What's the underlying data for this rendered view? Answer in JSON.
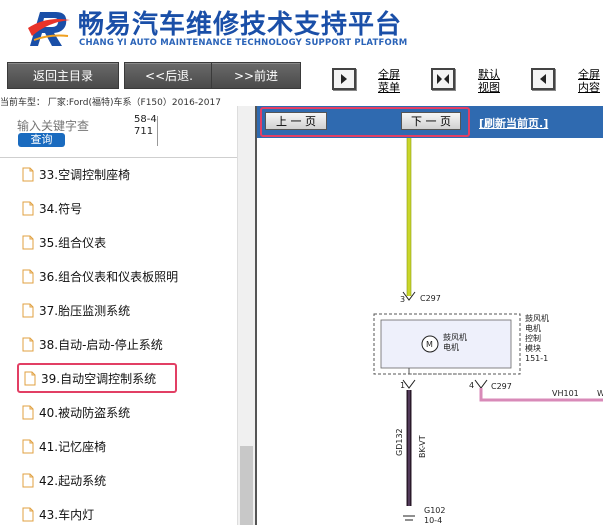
{
  "header": {
    "title": "畅易汽车维修技术支持平台",
    "subtitle": "CHANG YI AUTO MAINTENANCE TECHNOLOGY SUPPORT PLATFORM"
  },
  "toolbar": {
    "home_label": "返回主目录",
    "back_label": "<<后退.",
    "forward_label": ">>前进",
    "fullscreen_menu_line1": "全屏",
    "fullscreen_menu_line2": "菜单",
    "default_view_line1": "默认",
    "default_view_line2": "视图",
    "fullscreen_content_line1": "全屏",
    "fullscreen_content_line2": "内容"
  },
  "vehicle_info": "当前车型：  厂家:Ford(福特)车系（F150）2016-2017",
  "search": {
    "placeholder": "输入关键字查",
    "button_label": "查询",
    "page_ref": "58-4711"
  },
  "sidebar_items": [
    {
      "label": "33.空调控制座椅",
      "selected": false
    },
    {
      "label": "34.符号",
      "selected": false
    },
    {
      "label": "35.组合仪表",
      "selected": false
    },
    {
      "label": "36.组合仪表和仪表板照明",
      "selected": false
    },
    {
      "label": "37.胎压监测系统",
      "selected": false
    },
    {
      "label": "38.自动-启动-停止系统",
      "selected": false
    },
    {
      "label": "39.自动空调控制系统",
      "selected": true
    },
    {
      "label": "40.被动防盗系统",
      "selected": false
    },
    {
      "label": "41.记忆座椅",
      "selected": false
    },
    {
      "label": "42.起动系统",
      "selected": false
    },
    {
      "label": "43.车内灯",
      "selected": false
    }
  ],
  "diagram": {
    "prev_label": "上 一 页",
    "next_label": "下 一 页",
    "refresh_label": "[刷新当前页.]",
    "pin3": "3",
    "conn_top": "C297",
    "module_label_1": "鼓风机",
    "module_label_2": "电机",
    "module_label_3": "控制",
    "module_label_4": "模块",
    "module_label_5": "151-1",
    "motor_symbol": "M",
    "motor_text_1": "鼓风机",
    "motor_text_2": "电机",
    "pin1": "1",
    "pin4": "4",
    "conn_right": "C297",
    "wire_right": "VH101",
    "wire_right_trunc": "W",
    "wire_gd": "GD132",
    "wire_color": "BK-VT",
    "ground": "G102",
    "ground_ref": "10-4"
  },
  "colors": {
    "brand_blue": "#1a4fa8",
    "highlight": "#e23f64",
    "pane_blue": "#2f6ab0",
    "wire_yellow": "#c9d62a",
    "wire_black": "#2a1a2a",
    "wire_pink": "#d88ab8"
  }
}
